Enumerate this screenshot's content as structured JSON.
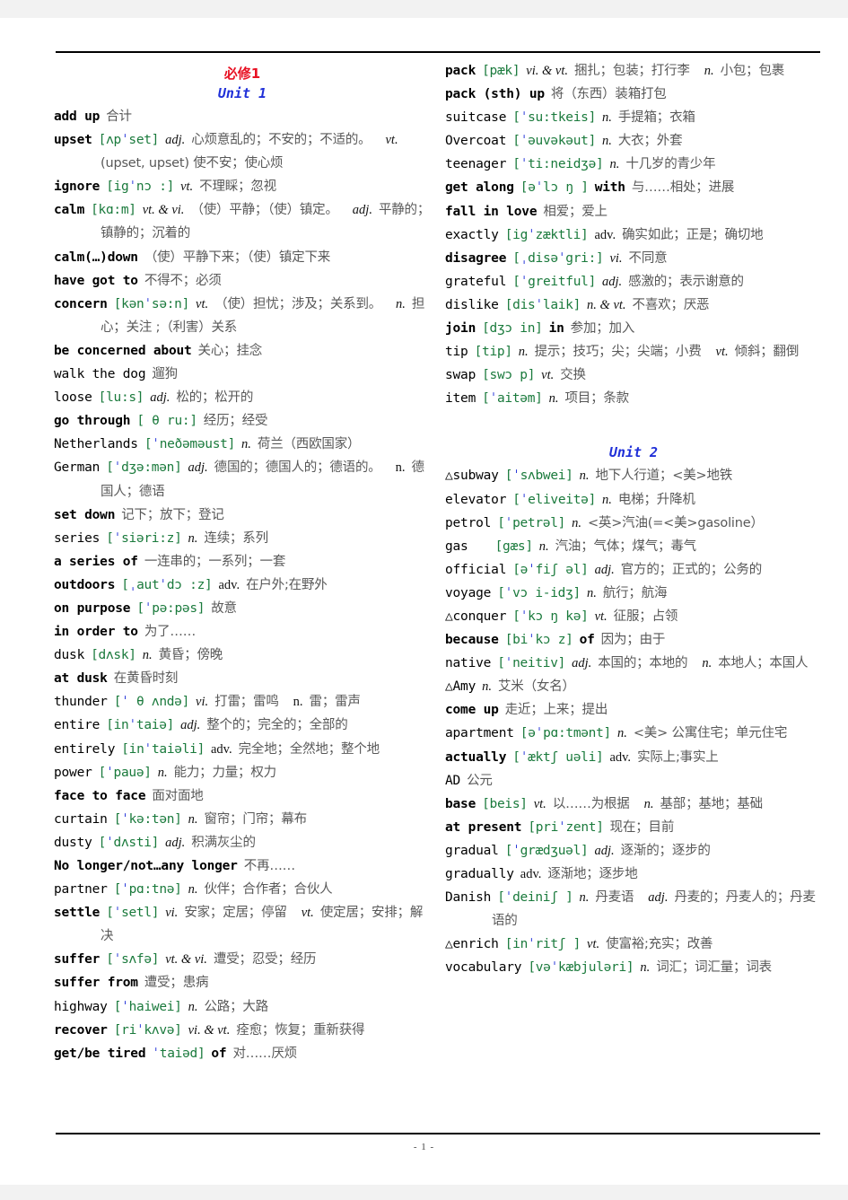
{
  "page": {
    "footer": "- 1 -",
    "colors": {
      "book_title": "#e81123",
      "unit_title": "#2030d8",
      "phonetic": "#1a7a3c",
      "stress_mark": "#2030d8",
      "chinese": "#585858",
      "word": "#000000"
    }
  },
  "left_column": {
    "book_title": "必修1",
    "unit_title": "Unit 1",
    "entries": [
      {
        "word": "add up",
        "bold": true,
        "cn": "合计"
      },
      {
        "word": "upset",
        "bold": true,
        "ph": "[ʌpˈset]",
        "pos": "adj.",
        "cn": "心烦意乱的；不安的；不适的。",
        "pos2": "vt.",
        "cn2": "(upset, upset) 使不安；使心烦"
      },
      {
        "word": "ignore",
        "bold": true,
        "ph": "[igˈnɔ :]",
        "pos": "vt.",
        "cn": "不理睬；忽视"
      },
      {
        "word": "calm",
        "bold": true,
        "ph": "[kɑ:m]",
        "pos": "vt. & vi.",
        "cn": "（使）平静；（使）镇定。",
        "pos2": "adj.",
        "cn2": "平静的；镇静的；沉着的"
      },
      {
        "word": "calm(…)down",
        "bold": true,
        "cn": "（使）平静下来；（使）镇定下来"
      },
      {
        "word": "have got to",
        "bold": true,
        "cn": "不得不；必须"
      },
      {
        "word": "concern",
        "bold": true,
        "ph": "[kənˈsə:n]",
        "pos": "vt.",
        "cn": "（使）担忧；涉及；关系到。",
        "pos2": "n.",
        "cn2": "担心；关注 ;（利害）关系"
      },
      {
        "word": "be concerned about",
        "bold": true,
        "cn": "关心；挂念"
      },
      {
        "word": "walk the dog",
        "bold": false,
        "cn": "遛狗"
      },
      {
        "word": "loose",
        "bold": false,
        "ph": "[lu:s]",
        "pos": "adj.",
        "cn": "松的；松开的"
      },
      {
        "word": "go through",
        "bold": true,
        "ph": "[ θ ru:]",
        "cn": "经历；经受"
      },
      {
        "word": "Netherlands",
        "bold": false,
        "ph": "[ˈneðəməust]",
        "pos": "n.",
        "cn": "荷兰（西欧国家）"
      },
      {
        "word": "German",
        "bold": false,
        "ph": "[ˈdʒə:mən]",
        "pos": "adj.",
        "cn": "德国的；德国人的；德语的。",
        "pos2": "n.",
        "pos2_upright": true,
        "cn2": "德国人；德语"
      },
      {
        "word": "set down",
        "bold": true,
        "cn": "记下；放下；登记"
      },
      {
        "word": "series",
        "bold": false,
        "ph": "[ˈsiəri:z]",
        "pos": "n.",
        "cn": "连续；系列"
      },
      {
        "word": "a series of",
        "bold": true,
        "cn": "一连串的；一系列；一套"
      },
      {
        "word": "outdoors",
        "bold": true,
        "ph": "[ˌautˈdɔ :z]",
        "pos": "adv.",
        "pos_upright": true,
        "cn": "在户外;在野外"
      },
      {
        "word": "on purpose",
        "bold": true,
        "ph": "[ˈpə:pəs]",
        "cn": "故意"
      },
      {
        "word": "in order to",
        "bold": true,
        "cn": "为了……"
      },
      {
        "word": "dusk",
        "bold": false,
        "ph": "[dʌsk]",
        "pos": "n.",
        "cn": "黄昏；傍晚"
      },
      {
        "word": "at dusk",
        "bold": true,
        "cn": "在黄昏时刻"
      },
      {
        "word": "thunder",
        "bold": false,
        "ph": "[ˈ θ ʌndə]",
        "pos": "vi.",
        "cn": "打雷；雷鸣",
        "pos2": "n.",
        "pos2_upright": true,
        "cn2": "雷；雷声"
      },
      {
        "word": "entire",
        "bold": false,
        "ph": "[inˈtaiə]",
        "pos": "adj.",
        "cn": "整个的；完全的；全部的"
      },
      {
        "word": "entirely",
        "bold": false,
        "ph": "[inˈtaiəli]",
        "pos": "adv.",
        "pos_upright": true,
        "cn": "完全地；全然地；整个地"
      },
      {
        "word": "power",
        "bold": false,
        "ph": "[ˈpauə]",
        "pos": "n.",
        "cn": "能力；力量；权力"
      },
      {
        "word": "face to face",
        "bold": true,
        "cn": "面对面地"
      },
      {
        "word": "curtain",
        "bold": false,
        "ph": "[ˈkə:tən]",
        "pos": "n.",
        "cn": "窗帘；门帘；幕布"
      },
      {
        "word": "dusty",
        "bold": false,
        "ph": "[ˈdʌsti]",
        "pos": "adj.",
        "cn": "积满灰尘的"
      },
      {
        "word": "No longer/not…any longer",
        "bold": true,
        "cn": "不再……"
      },
      {
        "word": "partner",
        "bold": false,
        "ph": "[ˈpɑ:tnə]",
        "pos": "n.",
        "cn": "伙伴；合作者；合伙人"
      },
      {
        "word": "settle",
        "bold": true,
        "ph": "[ˈsetl]",
        "pos": "vi.",
        "cn": "安家；定居；停留",
        "pos2": "vt.",
        "cn2": "使定居；安排；解决"
      },
      {
        "word": "suffer",
        "bold": true,
        "ph": "[ˈsʌfə]",
        "pos": "vt. & vi.",
        "cn": "遭受；忍受；经历"
      },
      {
        "word": "suffer from",
        "bold": true,
        "cn": "遭受；患病"
      },
      {
        "word": "highway",
        "bold": false,
        "ph": "[ˈhaiwei]",
        "pos": "n.",
        "cn": "公路；大路"
      },
      {
        "word": "recover",
        "bold": true,
        "ph": "[riˈkʌvə]",
        "pos": "vi. & vt.",
        "cn": "痊愈；恢复；重新获得"
      },
      {
        "word": "get/be tired",
        "bold": true,
        "ph": "ˈtaiəd]",
        "word_tail": "of",
        "cn": "对……厌烦"
      }
    ]
  },
  "right_column": {
    "entries_unit1": [
      {
        "word": "pack",
        "bold": true,
        "ph": "[pæk]",
        "pos": "vi. & vt.",
        "cn": "捆扎；包装；打行李",
        "pos2": "n.",
        "cn2": "小包；包裹"
      },
      {
        "word": "pack (sth) up",
        "bold": true,
        "cn": "将（东西）装箱打包"
      },
      {
        "word": "suitcase",
        "bold": false,
        "ph": "[ˈsu:tkeis]",
        "pos": "n.",
        "cn": "手提箱；衣箱"
      },
      {
        "word": "Overcoat",
        "bold": false,
        "ph": "[ˈəuvəkəut]",
        "pos": "n.",
        "cn": "大衣；外套"
      },
      {
        "word": "teenager",
        "bold": false,
        "ph": "[ˈti:neidʒə]",
        "pos": "n.",
        "cn": "十几岁的青少年"
      },
      {
        "word": "get along",
        "bold": true,
        "ph": "[əˈlɔ ŋ ]",
        "word_tail": "with",
        "cn": "与……相处；进展"
      },
      {
        "word": "fall in love",
        "bold": true,
        "cn": "相爱；爱上"
      },
      {
        "word": "exactly",
        "bold": false,
        "ph": "[igˈzæktli]",
        "pos": "adv.",
        "pos_upright": true,
        "cn": "确实如此；正是；确切地"
      },
      {
        "word": "disagree",
        "bold": true,
        "ph": "[ˌdisəˈgri:]",
        "pos": "vi.",
        "cn": "不同意"
      },
      {
        "word": "grateful",
        "bold": false,
        "ph": "[ˈgreitful]",
        "pos": "adj.",
        "cn": "感激的；表示谢意的"
      },
      {
        "word": "dislike",
        "bold": false,
        "ph": "[disˈlaik]",
        "pos": "n. & vt.",
        "cn": "不喜欢；厌恶"
      },
      {
        "word": "join",
        "bold": true,
        "ph": "[dʒɔ in]",
        "word_tail": "in",
        "cn": "参加；加入"
      },
      {
        "word": "tip",
        "bold": false,
        "ph": "[tip]",
        "pos": "n.",
        "cn": "提示；技巧；尖；尖端；小费",
        "pos2": "vt.",
        "cn2": "倾斜；翻倒"
      },
      {
        "word": "swap",
        "bold": false,
        "ph": "[swɔ p]",
        "pos": "vt.",
        "cn": "交换"
      },
      {
        "word": "item",
        "bold": false,
        "ph": "[ˈaitəm]",
        "pos": "n.",
        "cn": "项目；条款"
      }
    ],
    "unit_title": "Unit 2",
    "entries_unit2": [
      {
        "word": "△subway",
        "bold": false,
        "ph": "[ˈsʌbwei]",
        "pos": "n.",
        "cn": "地下人行道；<美>地铁"
      },
      {
        "word": "elevator",
        "bold": false,
        "ph": "[ˈeliveitə]",
        "pos": "n.",
        "cn": "电梯；升降机"
      },
      {
        "word": "petrol",
        "bold": false,
        "ph": "[ˈpetrəl]",
        "pos": "n.",
        "cn": "<英>汽油(=<美>gasoline）"
      },
      {
        "word": "gas",
        "bold": false,
        "ph": "[gæs]",
        "pos": "n.",
        "cn": "汽油；气体；煤气；毒气",
        "gap": true
      },
      {
        "word": "official",
        "bold": false,
        "ph": "[əˈfiʃ əl]",
        "pos": "adj.",
        "cn": "官方的；正式的；公务的"
      },
      {
        "word": "voyage",
        "bold": false,
        "ph": "[ˈvɔ i-idʒ]",
        "pos": "n.",
        "cn": "航行；航海"
      },
      {
        "word": "△conquer",
        "bold": false,
        "ph": "[ˈkɔ ŋ kə]",
        "pos": "vt.",
        "cn": "征服；占领"
      },
      {
        "word": "because",
        "bold": true,
        "ph": "[biˈkɔ z]",
        "word_tail": "of",
        "cn": "因为；由于"
      },
      {
        "word": "native",
        "bold": false,
        "ph": "[ˈneitiv]",
        "pos": "adj.",
        "cn": "本国的；本地的",
        "pos2": "n.",
        "cn2": "本地人；本国人"
      },
      {
        "word": "△Amy",
        "bold": false,
        "pos": "n.",
        "cn": "艾米（女名）"
      },
      {
        "word": "come up",
        "bold": true,
        "cn": "走近；上来；提出"
      },
      {
        "word": "apartment",
        "bold": false,
        "ph": "[əˈpɑ:tmənt]",
        "pos": "n.",
        "cn": "<美> 公寓住宅；单元住宅"
      },
      {
        "word": "actually",
        "bold": true,
        "ph": "[ˈæktʃ uəli]",
        "pos": "adv.",
        "pos_upright": true,
        "cn": "实际上;事实上"
      },
      {
        "word": "AD",
        "bold": false,
        "cn": "公元"
      },
      {
        "word": "base",
        "bold": true,
        "ph": "[beis]",
        "pos": "vt.",
        "cn": "以……为根据",
        "pos2": "n.",
        "cn2": "基部；基地；基础"
      },
      {
        "word": "at present",
        "bold": true,
        "ph": "[priˈzent]",
        "cn": "现在；目前"
      },
      {
        "word": "gradual",
        "bold": false,
        "ph": "[ˈgrædʒuəl]",
        "pos": "adj.",
        "cn": "逐渐的；逐步的"
      },
      {
        "word": "gradually",
        "bold": false,
        "pos": "adv.",
        "pos_upright": true,
        "cn": "逐渐地；逐步地"
      },
      {
        "word": "Danish",
        "bold": false,
        "ph": "[ˈdeiniʃ ]",
        "pos": "n.",
        "cn": "丹麦语",
        "pos2": "adj.",
        "cn2": "丹麦的；丹麦人的；丹麦语的"
      },
      {
        "word": "△enrich",
        "bold": false,
        "ph": "[inˈritʃ ]",
        "pos": "vt.",
        "cn": "使富裕;充实；改善"
      },
      {
        "word": "vocabulary",
        "bold": false,
        "ph": "[vəˈkæbjuləri]",
        "pos": "n.",
        "cn": "词汇；词汇量；词表"
      }
    ]
  }
}
